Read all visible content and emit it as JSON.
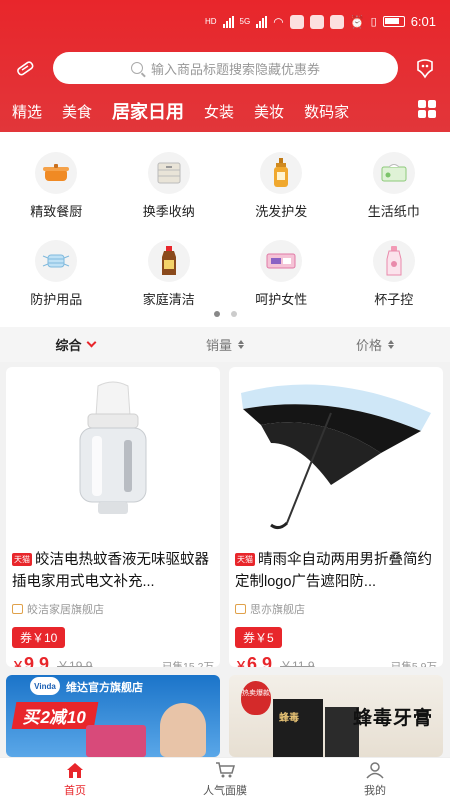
{
  "status_bar": {
    "time": "6:01",
    "network_labels": [
      "HD",
      "HD",
      "5G"
    ]
  },
  "header": {
    "search_placeholder": "输入商品标题搜索隐藏优惠券",
    "tabs": [
      {
        "label": "精选",
        "active": false
      },
      {
        "label": "美食",
        "active": false
      },
      {
        "label": "居家日用",
        "active": true
      },
      {
        "label": "女装",
        "active": false
      },
      {
        "label": "美妆",
        "active": false
      },
      {
        "label": "数码家",
        "active": false
      }
    ],
    "accent_color": "#e8262b"
  },
  "categories": [
    {
      "label": "精致餐厨",
      "icon": "pot-icon"
    },
    {
      "label": "换季收纳",
      "icon": "storage-drawer-icon"
    },
    {
      "label": "洗发护发",
      "icon": "shampoo-bottle-icon"
    },
    {
      "label": "生活纸巾",
      "icon": "tissue-box-icon"
    },
    {
      "label": "防护用品",
      "icon": "face-mask-icon"
    },
    {
      "label": "家庭清洁",
      "icon": "disinfectant-bottle-icon"
    },
    {
      "label": "呵护女性",
      "icon": "sanitary-pad-icon"
    },
    {
      "label": "杯子控",
      "icon": "cup-bottle-icon"
    }
  ],
  "sort_bar": {
    "comprehensive": "综合",
    "sales": "销量",
    "price": "价格"
  },
  "products": [
    {
      "badge": "天猫",
      "title": "皎洁电热蚊香液无味驱蚊器插电家用式电文补充...",
      "shop": "皎洁家居旗舰店",
      "coupon": "券￥10",
      "currency": "￥",
      "price": "9.9",
      "original_price": "￥19.9",
      "sold": "已售15.2万"
    },
    {
      "badge": "天猫",
      "title": "晴雨伞自动两用男折叠简约定制logo广告遮阳防...",
      "shop": "思亦旗舰店",
      "coupon": "券￥5",
      "currency": "￥",
      "price": "6.9",
      "original_price": "￥11.9",
      "sold": "已售5.9万"
    }
  ],
  "banners": [
    {
      "brand": "Vinda",
      "store": "维达官方旗舰店",
      "promo": "买2减10"
    },
    {
      "hot": "热卖爆款",
      "brand_mark": "蜂毒",
      "name": "蜂毒牙膏"
    }
  ],
  "bottom_nav": [
    {
      "label": "首页",
      "icon": "home-icon",
      "active": true
    },
    {
      "label": "人气面膜",
      "icon": "cart-icon",
      "active": false
    },
    {
      "label": "我的",
      "icon": "user-icon",
      "active": false
    }
  ]
}
